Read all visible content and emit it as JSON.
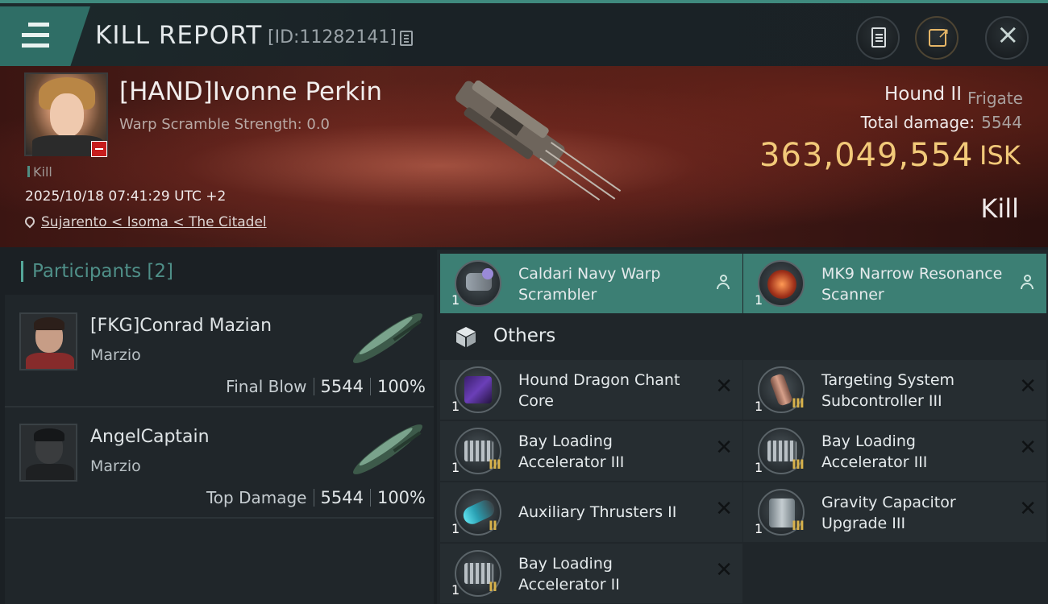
{
  "header": {
    "title": "KILL REPORT",
    "report_id": "[ID:11282141]",
    "icons": {
      "menu": "menu-icon",
      "copy": "copy-icon",
      "clipboard": "clipboard-icon",
      "share": "share-icon",
      "close": "close-icon"
    }
  },
  "victim": {
    "name": "[HAND]Ivonne Perkin",
    "warp_scramble": "Warp Scramble Strength: 0.0",
    "kill_tag": "Kill",
    "datetime": "2025/10/18 07:41:29 UTC +2",
    "location": "Sujarento < Isoma < The Citadel",
    "ship": "Hound II",
    "ship_class": "Frigate",
    "damage_label": "Total damage:",
    "damage_value": "5544",
    "isk_value": "363,049,554",
    "isk_unit": "ISK",
    "result": "Kill"
  },
  "participants": {
    "title": "Participants [2]",
    "rows": [
      {
        "name": "[FKG]Conrad Mazian",
        "corp": "Marzio",
        "role": "Final Blow",
        "damage": "5544",
        "percent": "100%"
      },
      {
        "name": "AngelCaptain",
        "corp": "Marzio",
        "role": "Top Damage",
        "damage": "5544",
        "percent": "100%"
      }
    ]
  },
  "modules": {
    "active": [
      {
        "name": "Caldari Navy Warp Scrambler",
        "qty": "1",
        "icon": "warp-scrambler-icon"
      },
      {
        "name": "MK9 Narrow Resonance Scanner",
        "qty": "1",
        "icon": "resonance-scanner-icon"
      }
    ],
    "others_title": "Others",
    "others": [
      {
        "name": "Hound Dragon Chant Core",
        "qty": "1",
        "tier": "",
        "icon": "core-icon"
      },
      {
        "name": "Targeting System Subcontroller III",
        "qty": "1",
        "tier": "III",
        "icon": "targeting-icon"
      },
      {
        "name": "Bay Loading Accelerator III",
        "qty": "1",
        "tier": "III",
        "icon": "bay-loader-icon"
      },
      {
        "name": "Bay Loading Accelerator III",
        "qty": "1",
        "tier": "III",
        "icon": "bay-loader-icon"
      },
      {
        "name": "Auxiliary Thrusters II",
        "qty": "1",
        "tier": "II",
        "icon": "thruster-icon"
      },
      {
        "name": "Gravity Capacitor Upgrade III",
        "qty": "1",
        "tier": "III",
        "icon": "capacitor-icon"
      },
      {
        "name": "Bay Loading Accelerator II",
        "qty": "1",
        "tier": "II",
        "icon": "bay-loader-icon"
      }
    ]
  },
  "colors": {
    "accent": "#3c7f74",
    "isk": "#f2c979",
    "hero_bg": "#4a1c17"
  }
}
